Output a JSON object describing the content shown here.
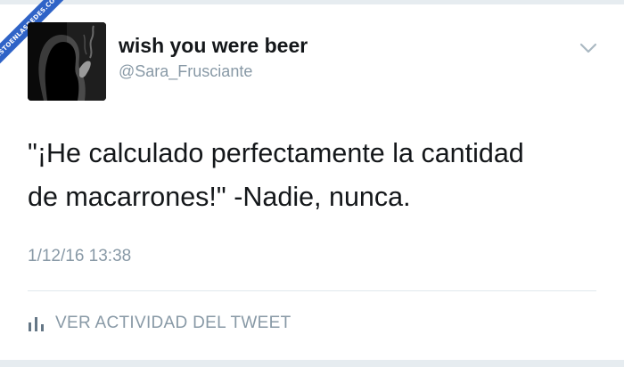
{
  "tweet": {
    "display_name": "wish you were beer",
    "handle": "@Sara_Frusciante",
    "text_line1": "\"¡He calculado perfectamente la cantidad",
    "text_line2": "de macarrones!\" -Nadie, nunca.",
    "timestamp": "1/12/16 13:38",
    "activity_label": "VER ACTIVIDAD DEL TWEET"
  },
  "watermark": {
    "text": "VISTOENLASREDES.COM"
  },
  "icons": {
    "chevron": "chevron-down-icon",
    "activity": "bar-chart-icon"
  },
  "colors": {
    "text_primary": "#14171a",
    "text_secondary": "#8899a6",
    "divider": "#e1e8ed",
    "watermark": "#2f63c7"
  }
}
